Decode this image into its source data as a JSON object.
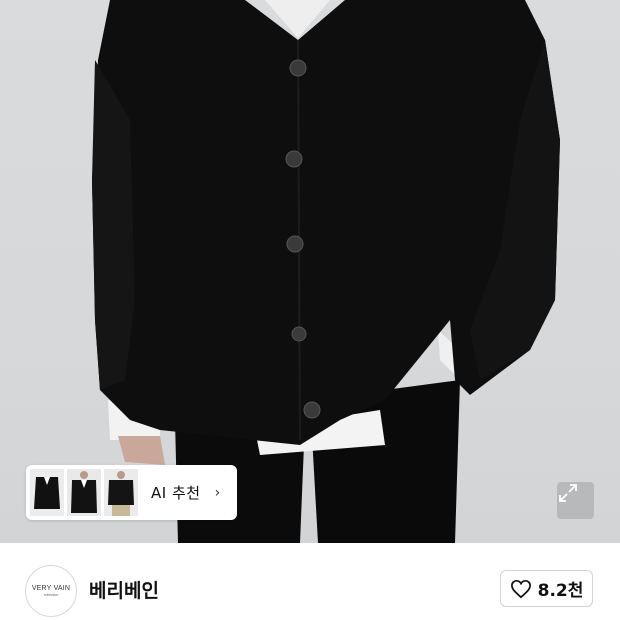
{
  "product": {
    "image_alt": "black oversized v-neck cardigan",
    "expand_icon": "expand-arrows-icon"
  },
  "ai_recommend": {
    "label": "AI 추천",
    "chevron": "›",
    "thumbnails": [
      "thumb-1",
      "thumb-2",
      "thumb-3"
    ]
  },
  "brand": {
    "logo_line1": "VERY VAIN",
    "logo_line2": "collection",
    "name": "베리베인"
  },
  "like": {
    "icon": "heart-outline-icon",
    "count": "8.2천"
  },
  "colors": {
    "background": "#d8dadc",
    "garment": "#0d0d0d",
    "text": "#111111"
  }
}
